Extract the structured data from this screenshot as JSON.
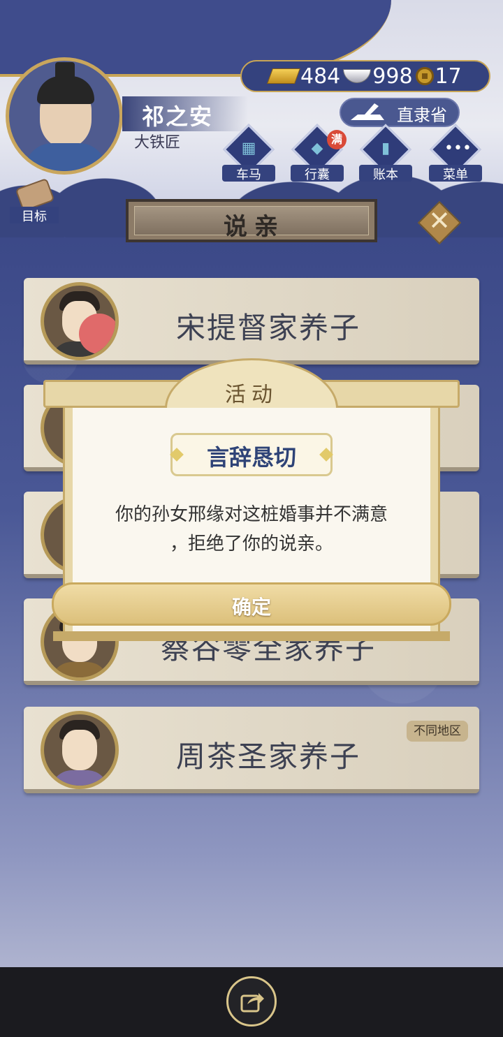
{
  "player": {
    "name": "祁之安",
    "title": "大铁匠"
  },
  "resources": {
    "gold": "484",
    "silver": "998",
    "coins": "17"
  },
  "region": "直隶省",
  "menu": [
    {
      "label": "车马",
      "icon": "carriage-icon"
    },
    {
      "label": "行囊",
      "icon": "bag-icon",
      "badge": "满"
    },
    {
      "label": "账本",
      "icon": "ledger-icon"
    },
    {
      "label": "菜单",
      "icon": "more-icon"
    }
  ],
  "target_label": "目标",
  "page_title": "说亲",
  "candidates": [
    {
      "name": "宋提督家养子",
      "tag": ""
    },
    {
      "name": "",
      "tag": ""
    },
    {
      "name": "",
      "tag": ""
    },
    {
      "name": "蔡谷零全家养子",
      "tag": ""
    },
    {
      "name": "周茶圣家养子",
      "tag": "不同地区"
    }
  ],
  "dialog": {
    "title": "活动",
    "heading": "言辞恳切",
    "message_line1": "你的孙女邢缘对这桩婚事并不满意",
    "message_line2": "，拒绝了你的说亲。",
    "confirm": "确定"
  },
  "colors": {
    "primary_blue": "#3d4a86",
    "gold_border": "#c8a556",
    "heading_blue": "#2e4377"
  }
}
